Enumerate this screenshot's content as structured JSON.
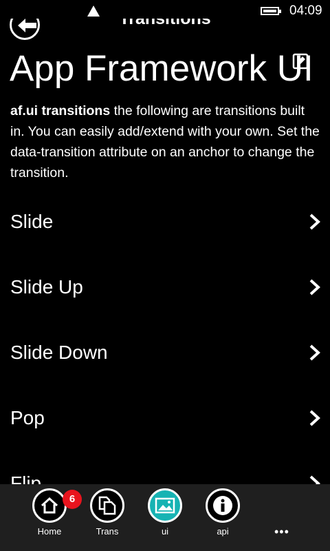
{
  "status": {
    "time": "04:09"
  },
  "header": {
    "title": "Transitions",
    "back_icon": "back-arrow-icon"
  },
  "page": {
    "title": "App Framework UI",
    "intro_bold": "af.ui transitions",
    "intro_text": " the following are transitions built in. You can easily add/extend with your own. Set the data-transition attribute on an anchor to change the transition."
  },
  "list": {
    "items": [
      {
        "label": "Slide"
      },
      {
        "label": "Slide Up"
      },
      {
        "label": "Slide Down"
      },
      {
        "label": "Pop"
      },
      {
        "label": "Flip"
      }
    ]
  },
  "nav": {
    "home": {
      "label": "Home",
      "badge": "6"
    },
    "trans": {
      "label": "Trans"
    },
    "ui": {
      "label": "ui"
    },
    "api": {
      "label": "api"
    },
    "more": "•••"
  },
  "colors": {
    "background": "#000000",
    "nav_bg": "#1f1f1f",
    "active": "#16b3b3",
    "badge": "#e8141e"
  }
}
